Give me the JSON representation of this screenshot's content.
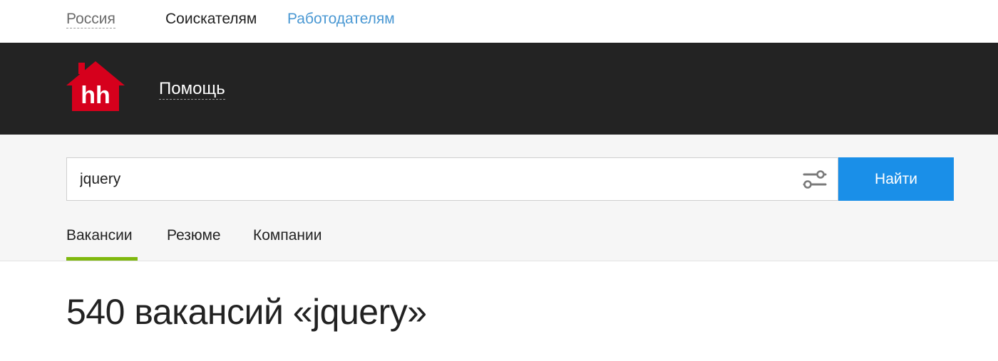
{
  "topbar": {
    "region": "Россия",
    "seekers": "Соискателям",
    "employers": "Работодателям"
  },
  "header": {
    "logo_text": "hh",
    "help": "Помощь"
  },
  "search": {
    "query": "jquery",
    "submit_label": "Найти",
    "filter_icon": "settings-sliders-icon"
  },
  "tabs": [
    {
      "label": "Вакансии",
      "active": true
    },
    {
      "label": "Резюме",
      "active": false
    },
    {
      "label": "Компании",
      "active": false
    }
  ],
  "results": {
    "title": "540 вакансий «jquery»"
  },
  "colors": {
    "brand_red": "#d6001c",
    "header_bg": "#232323",
    "button_blue": "#1a8fe8",
    "employers_link": "#4a98d3",
    "active_tab": "#7fb80e"
  }
}
